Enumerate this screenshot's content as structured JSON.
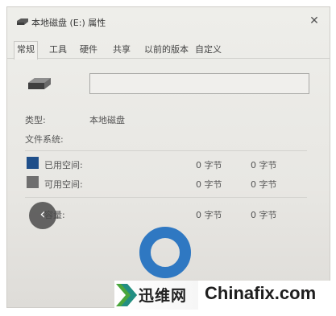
{
  "window": {
    "title": "本地磁盘 (E:) 属性",
    "close_glyph": "✕"
  },
  "tabs": [
    {
      "label": "常规",
      "active": true
    },
    {
      "label": "工具",
      "active": false
    },
    {
      "label": "硬件",
      "active": false
    },
    {
      "label": "共享",
      "active": false
    },
    {
      "label": "以前的版本",
      "active": false
    },
    {
      "label": "自定义",
      "active": false
    }
  ],
  "general": {
    "drive_name_value": "",
    "type_label": "类型:",
    "type_value": "本地磁盘",
    "filesystem_label": "文件系统:",
    "filesystem_value": ""
  },
  "space": {
    "used": {
      "label": "已用空间:",
      "bytes": "0 字节",
      "size": "0 字节",
      "color": "#1f4f8a"
    },
    "free": {
      "label": "可用空间:",
      "bytes": "0 字节",
      "size": "0 字节",
      "color": "#6f6f6f"
    },
    "capacity": {
      "label": "容量:",
      "bytes": "0 字节",
      "size": "0 字节"
    }
  },
  "chart": {
    "ring_color": "#2f78c2",
    "used_fraction": 0
  },
  "overlay": {
    "back_glyph": "‹"
  },
  "watermark": {
    "site_cn": "迅维网",
    "site_en": "Chinafix.com"
  },
  "colors": {
    "window_bg": "#eceae6",
    "logo_green": "#4aa63c",
    "logo_teal": "#1b8a8f"
  }
}
